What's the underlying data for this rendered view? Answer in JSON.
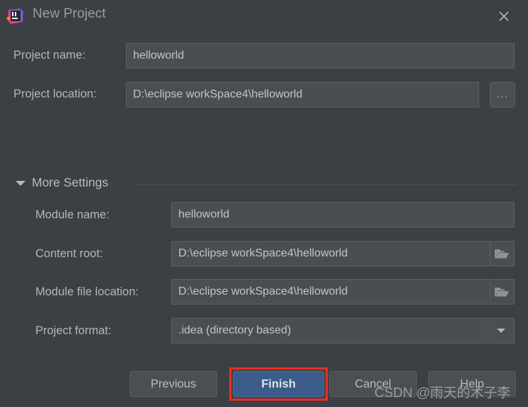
{
  "window": {
    "title": "New Project",
    "logo_icon": "intellij-idea-logo",
    "close_icon": "close-icon"
  },
  "top_form": {
    "project_name": {
      "label": "Project name:",
      "value": "helloworld",
      "placeholder": ""
    },
    "project_location": {
      "label": "Project location:",
      "value": "D:\\eclipse workSpace4\\helloworld",
      "placeholder": "",
      "browse_label": "...",
      "browse_icon": "ellipsis-icon"
    }
  },
  "more_settings": {
    "title": "More Settings",
    "expanded": true,
    "toggle_icon": "chevron-down-icon",
    "rows": [
      {
        "label": "Module name:",
        "value": "helloworld",
        "type": "text",
        "icon": ""
      },
      {
        "label": "Content root:",
        "value": "D:\\eclipse workSpace4\\helloworld",
        "type": "text-browse",
        "icon": "folder-icon"
      },
      {
        "label": "Module file location:",
        "value": "D:\\eclipse workSpace4\\helloworld",
        "type": "text-browse",
        "icon": "folder-icon"
      },
      {
        "label": "Project format:",
        "value": ".idea (directory based)",
        "type": "dropdown",
        "icon": "chevron-down-icon"
      }
    ]
  },
  "buttons": {
    "previous": "Previous",
    "finish": "Finish",
    "cancel": "Cancel",
    "help": "Help",
    "highlighted": "finish"
  },
  "watermark": {
    "text": "CSDN @雨天的木子李"
  },
  "colors": {
    "dialog_background": "#3c4044",
    "field_background": "#4a4e51",
    "field_border": "#5c6164",
    "text": "#b6b9bd",
    "primary_button": "#3b5c8a",
    "highlight": "#fe2a24"
  }
}
